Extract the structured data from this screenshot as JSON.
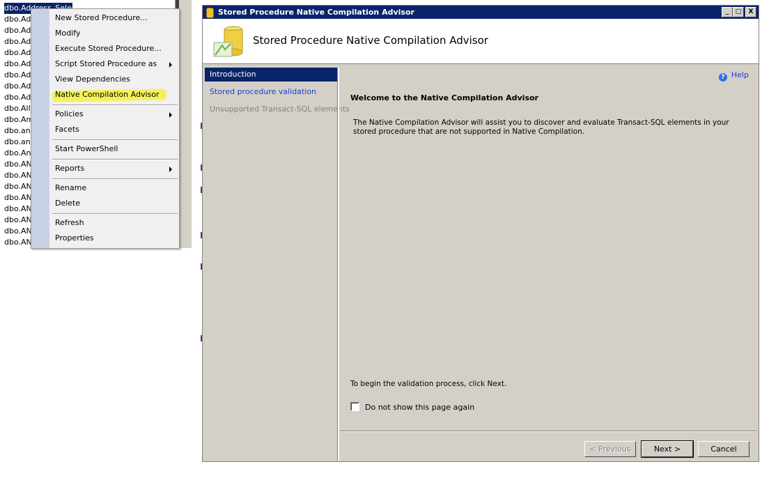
{
  "tree": {
    "items": [
      "dbo.Address_Select",
      "dbo.Add",
      "dbo.Add",
      "dbo.Add",
      "dbo.Add",
      "dbo.Add",
      "dbo.Add",
      "dbo.Ads",
      "dbo.Ads",
      "dbo.All_",
      "dbo.Am",
      "dbo.anc",
      "dbo.anI",
      "dbo.Ank",
      "dbo.ANI",
      "dbo.ANI",
      "dbo.ANI",
      "dbo.ANI",
      "dbo.ANI",
      "dbo.ANI",
      "dbo.ANI",
      "dbo.ANI"
    ]
  },
  "context_menu": {
    "items": [
      {
        "label": "New Stored Procedure...",
        "submenu": false
      },
      {
        "label": "Modify",
        "submenu": false
      },
      {
        "label": "Execute Stored Procedure...",
        "submenu": false
      },
      {
        "label": "Script Stored Procedure as",
        "submenu": true
      },
      {
        "label": "View Dependencies",
        "submenu": false
      },
      {
        "label": "Native Compilation Advisor",
        "submenu": false,
        "highlighted": true
      },
      {
        "label": "Policies",
        "submenu": true
      },
      {
        "label": "Facets",
        "submenu": false
      },
      {
        "label": "Start PowerShell",
        "submenu": false
      },
      {
        "label": "Reports",
        "submenu": true
      },
      {
        "label": "Rename",
        "submenu": false
      },
      {
        "label": "Delete",
        "submenu": false
      },
      {
        "label": "Refresh",
        "submenu": false
      },
      {
        "label": "Properties",
        "submenu": false
      }
    ],
    "highlight_color": "#f2f25a"
  },
  "dialog": {
    "title": "Stored Procedure Native Compilation Advisor",
    "header_title": "Stored Procedure Native Compilation Advisor",
    "title_buttons": [
      "_",
      "□",
      "X"
    ],
    "nav": [
      {
        "label": "Introduction",
        "state": "active"
      },
      {
        "label": "Stored procedure validation",
        "state": "link"
      },
      {
        "label": "Unsupported Transact-SQL elements",
        "state": "disabled"
      }
    ],
    "help_label": "Help",
    "welcome": "Welcome to the Native Compilation Advisor",
    "description": "The Native Compilation Advisor will assist you to discover and evaluate Transact-SQL elements in your stored procedure that are not supported in Native Compilation.",
    "begin_text": "To begin the validation process, click Next.",
    "checkbox_label": "Do not show this page again",
    "checkbox_checked": false,
    "buttons": {
      "previous": "< Previous",
      "next": "Next >",
      "cancel": "Cancel"
    }
  },
  "colors": {
    "selection": "#0a246a",
    "link": "#1a3fcf",
    "window_bg": "#d4d0c8"
  }
}
